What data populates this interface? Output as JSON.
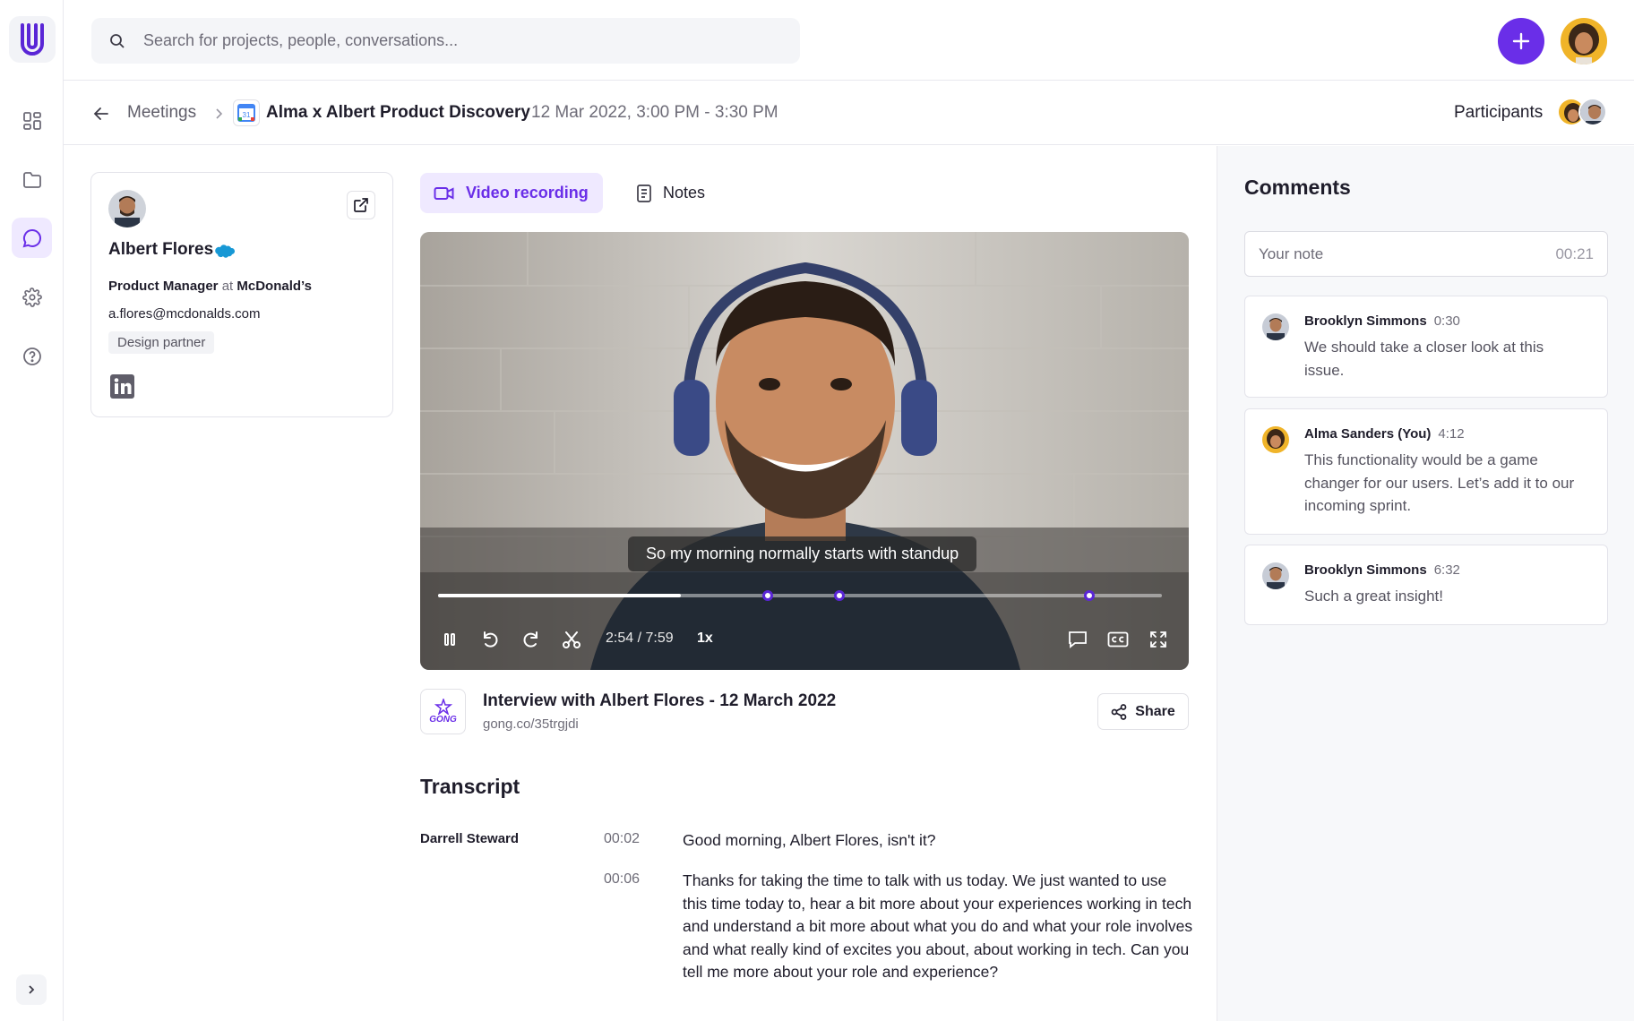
{
  "search": {
    "placeholder": "Search for projects, people, conversations..."
  },
  "breadcrumb": {
    "parent": "Meetings",
    "title": "Alma x Albert Product Discovery",
    "date": "12 Mar 2022, 3:00 PM - 3:30 PM",
    "calendar_badge": "31",
    "participants_label": "Participants"
  },
  "contact": {
    "name": "Albert Flores",
    "role": "Product Manager",
    "role_connector": "at",
    "company": "McDonald’s",
    "email": "a.flores@mcdonalds.com",
    "tag": "Design partner"
  },
  "tabs": [
    {
      "label": "Video recording",
      "active": true,
      "icon": "video-camera-icon"
    },
    {
      "label": "Notes",
      "active": false,
      "icon": "document-icon"
    }
  ],
  "video": {
    "caption": "So my morning normally starts with standup",
    "time": "2:54 / 7:59",
    "speed": "1x",
    "progress": 0.335,
    "markers": [
      0.455,
      0.555,
      0.9
    ]
  },
  "source": {
    "logo_text": "GONG",
    "title": "Interview with Albert Flores - 12 March 2022",
    "url": "gong.co/35trgjdi",
    "share_label": "Share"
  },
  "transcript": {
    "heading": "Transcript",
    "speaker": "Darrell Steward",
    "entries": [
      {
        "time": "00:02",
        "text": "Good morning, Albert Flores, isn't it?"
      },
      {
        "time": "00:06",
        "text": "Thanks for taking the time to talk with us today. We just wanted to use this time today to, hear a bit more about your experiences working in tech and understand a bit more about what you do and what your role involves and what really kind of excites you about, about working in tech. Can you tell me more about your role and experience?"
      }
    ]
  },
  "comments": {
    "heading": "Comments",
    "note_placeholder": "Your note",
    "note_time": "00:21",
    "items": [
      {
        "author": "Brooklyn Simmons",
        "time": "0:30",
        "text": "We should take a closer look at this issue."
      },
      {
        "author": "Alma Sanders (You)",
        "time": "4:12",
        "text": "This functionality would be a game changer for our users. Let’s add it to our incoming sprint."
      },
      {
        "author": "Brooklyn Simmons",
        "time": "6:32",
        "text": "Such a great insight!"
      }
    ]
  },
  "colors": {
    "accent": "#6a2ee8",
    "accent_soft": "#efe9ff",
    "salesforce": "#1798d5"
  }
}
